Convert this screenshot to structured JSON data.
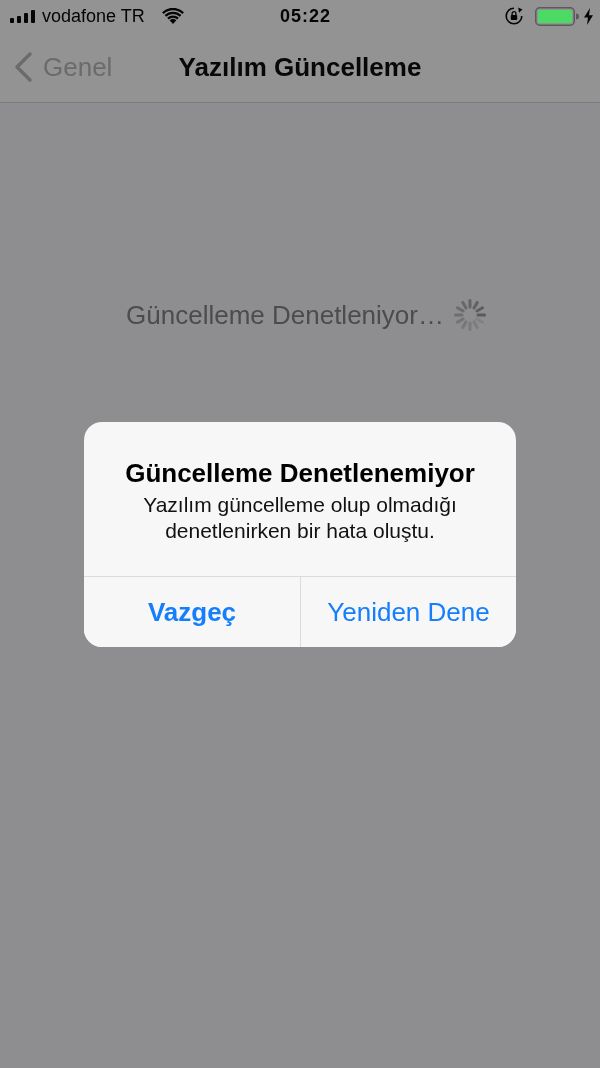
{
  "status_bar": {
    "carrier": "vodafone TR",
    "time": "05:22",
    "charging": true
  },
  "nav_bar": {
    "back_label": "Genel",
    "title": "Yazılım Güncelleme"
  },
  "content": {
    "status_text": "Güncelleme Denetleniyor…"
  },
  "alert": {
    "title": "Güncelleme Denetlenemiyor",
    "message": "Yazılım güncelleme olup olmadığı denetlenirken bir hata oluştu.",
    "actions": [
      {
        "label": "Vazgeç",
        "kind": "cancel"
      },
      {
        "label": "Yeniden Dene",
        "kind": "default"
      }
    ]
  }
}
